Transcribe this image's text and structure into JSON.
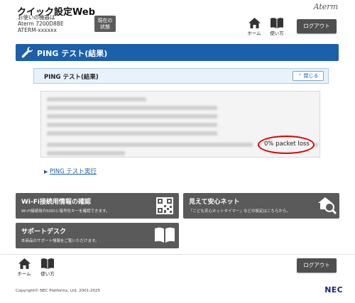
{
  "header": {
    "app_title": "クイック設定Web",
    "device_lines": [
      "お使いの機器は",
      "Aterm 7200D8BE",
      "ATERM-xxxxxx"
    ],
    "status_button": [
      "現在の",
      "状態"
    ],
    "brand_logo": "Aterm",
    "nav": {
      "home": "ホーム",
      "manual": "使い方"
    },
    "logout": "ログアウト"
  },
  "page": {
    "title": "PING テスト(結果)",
    "panel_title": "PING テスト(結果)",
    "close_button": "閉じる",
    "packet_loss": "0% packet loss",
    "link": "PING テスト実行",
    "link_bullet": "▶"
  },
  "cards": {
    "wifi": {
      "title": "Wi-Fi接続用情報の確認",
      "desc": "Wi-Fi接続用のSSIDと暗号化キーを確認できます。"
    },
    "safety": {
      "title": "見えて安心ネット",
      "desc": "「こども安心ネットタイマー」などの設定はこちらから。"
    },
    "support": {
      "title": "サポートデスク",
      "desc": "本商品のサポート情報をご覧いただけます。"
    }
  },
  "footer": {
    "nav": {
      "home": "ホーム",
      "manual": "使い方"
    },
    "logout": "ログアウト",
    "copyright": "Copyright© NEC Platforms, Ltd. 2001-2025",
    "logo": "NEC"
  },
  "colors": {
    "brand_blue": "#1c5fab",
    "button_gray": "#4f4f4f",
    "card_gray": "#5a5a5a",
    "highlight_red": "#e00000"
  }
}
